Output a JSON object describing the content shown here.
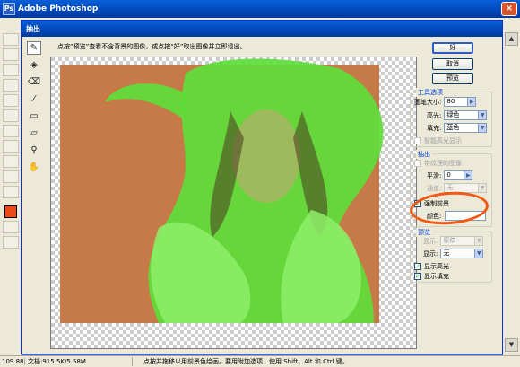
{
  "app": {
    "title": "Adobe Photoshop",
    "close_label": "×",
    "logo_glyph": "Ps"
  },
  "dialog": {
    "title": "抽出",
    "hint": "点按“预览”查看不含背景的图像，或点按“好”取出图像并立即退出。",
    "buttons": {
      "ok": "好",
      "cancel": "取消",
      "preview": "预览"
    },
    "tool_options": {
      "title": "工具选项",
      "brush_size_label": "画笔大小:",
      "brush_size_value": "80",
      "highlight_label": "高光:",
      "highlight_value": "绿色",
      "fill_label": "填充:",
      "fill_value": "蓝色",
      "smart_highlight_label": "智能高光显示"
    },
    "extraction": {
      "title": "抽出",
      "textured_label": "带纹理的图像",
      "smooth_label": "平滑:",
      "smooth_value": "0",
      "channel_label": "通道:",
      "channel_value": "无",
      "force_fg_label": "强制前景",
      "force_fg_checked": true,
      "color_label": "颜色:"
    },
    "preview_options": {
      "title": "预览",
      "show_label": "显示:",
      "show_value": "原稿",
      "display_label": "显示:",
      "display_value": "无",
      "show_highlight_label": "显示高光",
      "show_highlight_checked": true,
      "show_fill_label": "显示填充",
      "show_fill_checked": true
    }
  },
  "status": {
    "zoom": "109.88",
    "doc": "文档:915.5K/5.58M",
    "hint": "点按并拖移以用前景色绘画。要用附加选项，使用 Shift、Alt 和 Ctrl 键。"
  },
  "colors": {
    "accent": "#0a5fd8",
    "highlight_green": "#5ddd3a",
    "photo_bg": "#c57a47",
    "foreground_color": "#e84a1a",
    "annotation": "#f05a14"
  }
}
